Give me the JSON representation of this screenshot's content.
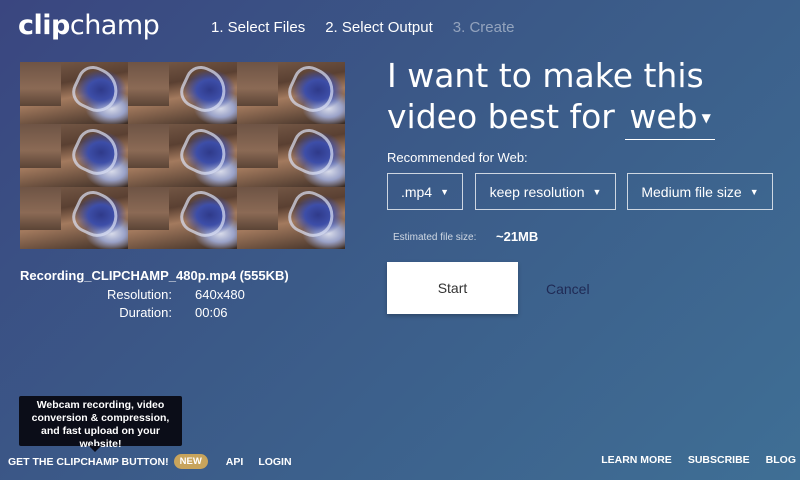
{
  "logo": {
    "part1": "clip",
    "part2": "champ"
  },
  "steps": [
    {
      "label": "1. Select Files",
      "active": true
    },
    {
      "label": "2. Select Output",
      "active": true
    },
    {
      "label": "3. Create",
      "active": false
    }
  ],
  "file": {
    "name": "Recording_CLIPCHAMP_480p.mp4 (555KB)",
    "resolution_label": "Resolution:",
    "resolution_value": "640x480",
    "duration_label": "Duration:",
    "duration_value": "00:06"
  },
  "headline": {
    "text": "I want to make this video best for",
    "target": "web"
  },
  "recommended_label": "Recommended for Web:",
  "options": {
    "format": ".mp4",
    "resolution": "keep resolution",
    "size": "Medium file size"
  },
  "estimate": {
    "label": "Estimated file size:",
    "value": "~21MB"
  },
  "actions": {
    "start": "Start",
    "cancel": "Cancel"
  },
  "tooltip": "Webcam recording, video conversion & compression, and fast upload on your website!",
  "footer": {
    "get_button": "GET THE CLIPCHAMP BUTTON!",
    "new_badge": "NEW",
    "api": "API",
    "login": "LOGIN",
    "learn_more": "LEARN MORE",
    "subscribe": "SUBSCRIBE",
    "blog": "BLOG"
  },
  "icons": {
    "caret": "caret-down-icon"
  },
  "colors": {
    "background_start": "#3a4680",
    "background_end": "#3f6f95",
    "badge": "#c8a45c"
  }
}
